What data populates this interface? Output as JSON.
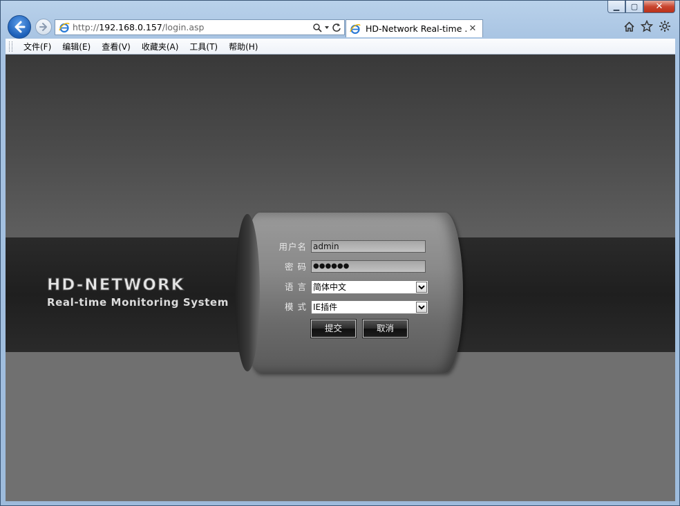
{
  "browser": {
    "address": {
      "prefix": "http://",
      "host": "192.168.0.157",
      "path": "/login.asp"
    },
    "tab_title": "HD-Network Real-time ...",
    "tab_close": "✕"
  },
  "window_controls": {
    "minimize": "▁",
    "maximize": "▢",
    "close": "✕"
  },
  "menu": [
    "文件(F)",
    "编辑(E)",
    "查看(V)",
    "收藏夹(A)",
    "工具(T)",
    "帮助(H)"
  ],
  "brand": {
    "title": "HD-NETWORK",
    "subtitle": "Real-time Monitoring System"
  },
  "login": {
    "username_label": "用户名",
    "username_value": "admin",
    "password_label": "密 码",
    "password_value": "●●●●●●",
    "language_label": "语 言",
    "language_value": "简体中文",
    "mode_label": "模 式",
    "mode_value": "IE插件",
    "submit_label": "提交",
    "cancel_label": "取消"
  },
  "colors": {
    "accent": "#1c5fb8",
    "panel": "#8a8a8a",
    "background": "#4a4a4a"
  }
}
